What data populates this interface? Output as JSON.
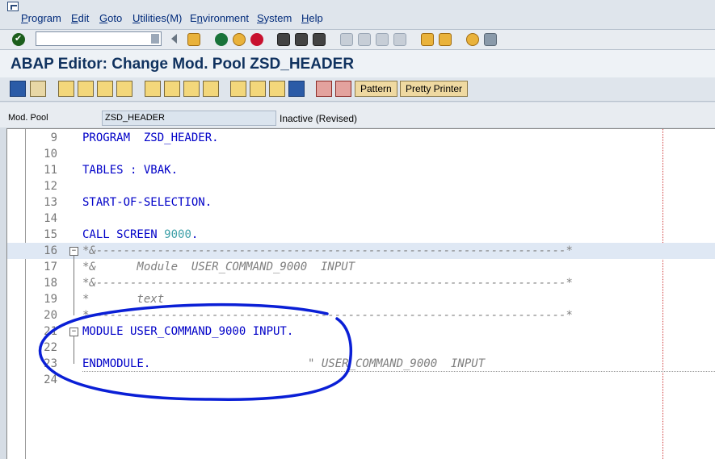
{
  "menu": {
    "items": [
      {
        "label": "Program",
        "underline": "P"
      },
      {
        "label": "Edit",
        "underline": "E"
      },
      {
        "label": "Goto",
        "underline": "G"
      },
      {
        "label": "Utilities(M)",
        "underline": "U"
      },
      {
        "label": "Environment",
        "underline": "n"
      },
      {
        "label": "System",
        "underline": "S"
      },
      {
        "label": "Help",
        "underline": "H"
      }
    ]
  },
  "command_field": {
    "value": ""
  },
  "title": "ABAP Editor: Change Mod. Pool ZSD_HEADER",
  "app_toolbar": {
    "pattern_label": "Pattern",
    "pretty_printer_label": "Pretty Printer"
  },
  "info": {
    "object_type_label": "Mod. Pool",
    "program_name": "ZSD_HEADER",
    "status": "Inactive (Revised)"
  },
  "editor": {
    "lines": [
      {
        "num": "9",
        "text": "PROGRAM  ZSD_HEADER.",
        "kind": "code"
      },
      {
        "num": "10",
        "text": "",
        "kind": "code"
      },
      {
        "num": "11",
        "text": "TABLES : VBAK.",
        "kind": "code"
      },
      {
        "num": "12",
        "text": "",
        "kind": "code"
      },
      {
        "num": "13",
        "text": "START-OF-SELECTION.",
        "kind": "code"
      },
      {
        "num": "14",
        "text": "",
        "kind": "code"
      },
      {
        "num": "15",
        "text": "CALL SCREEN 9000.",
        "kind": "code"
      },
      {
        "num": "16",
        "text": "*&---------------------------------------------------------------------*",
        "kind": "comment"
      },
      {
        "num": "17",
        "text": "*&      Module  USER_COMMAND_9000  INPUT",
        "kind": "comment"
      },
      {
        "num": "18",
        "text": "*&---------------------------------------------------------------------*",
        "kind": "comment"
      },
      {
        "num": "19",
        "text": "*       text",
        "kind": "comment"
      },
      {
        "num": "20",
        "text": "*----------------------------------------------------------------------*",
        "kind": "comment"
      },
      {
        "num": "21",
        "text": "MODULE USER_COMMAND_9000 INPUT.",
        "kind": "code"
      },
      {
        "num": "22",
        "text": "",
        "kind": "code"
      },
      {
        "num": "23",
        "text": "ENDMODULE.",
        "kind": "code"
      },
      {
        "num": "24",
        "text": "",
        "kind": "code"
      }
    ],
    "line23_comment": "\" USER_COMMAND_9000  INPUT"
  },
  "colors": {
    "keyword": "#0000c8",
    "number": "#3ea0a8",
    "comment": "#7f7f7f",
    "annotation": "#0a1fd6"
  }
}
